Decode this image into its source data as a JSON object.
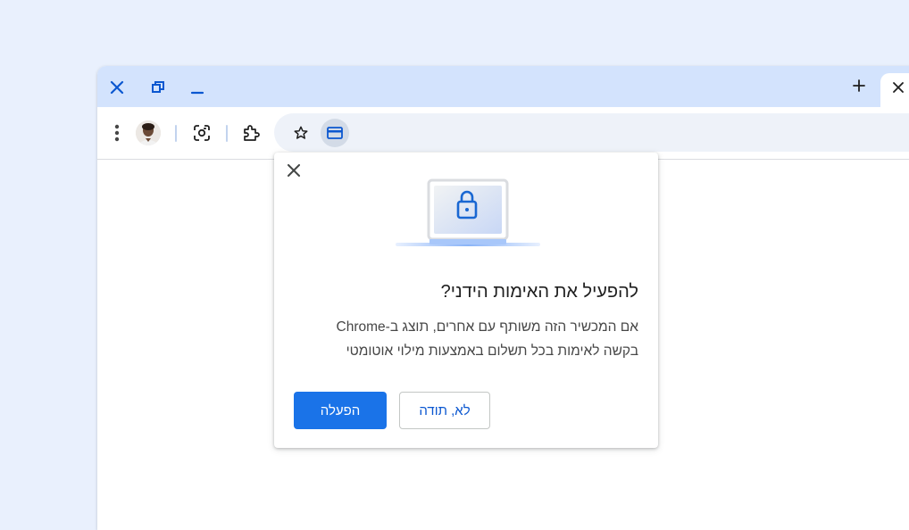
{
  "window": {
    "controls": [
      {
        "name": "close-window-icon"
      },
      {
        "name": "restore-window-icon"
      },
      {
        "name": "minimize-window-icon"
      }
    ],
    "new_tab_icon": "plus-icon",
    "tab_close_icon": "close-icon"
  },
  "toolbar": {
    "menu_icon": "more-vert-icon",
    "avatar": "profile-avatar",
    "lens_icon": "google-lens-icon",
    "extensions_icon": "puzzle-icon",
    "bookmark_icon": "star-icon",
    "payment_icon": "credit-card-icon"
  },
  "dialog": {
    "title": "להפעיל את האימות הידני?",
    "body_line1": "אם המכשיר הזה משותף עם אחרים, תוצג ב-Chrome",
    "body_line2": "בקשה לאימות בכל תשלום באמצעות מילוי אוטומטי",
    "confirm_label": "הפעלה",
    "cancel_label": "לא, תודה",
    "illustration": "laptop-lock-icon"
  },
  "colors": {
    "background": "#e9f0fd",
    "titlebar": "#d3e3fd",
    "accent": "#0b57d0",
    "primary_button": "#1a73e8"
  }
}
